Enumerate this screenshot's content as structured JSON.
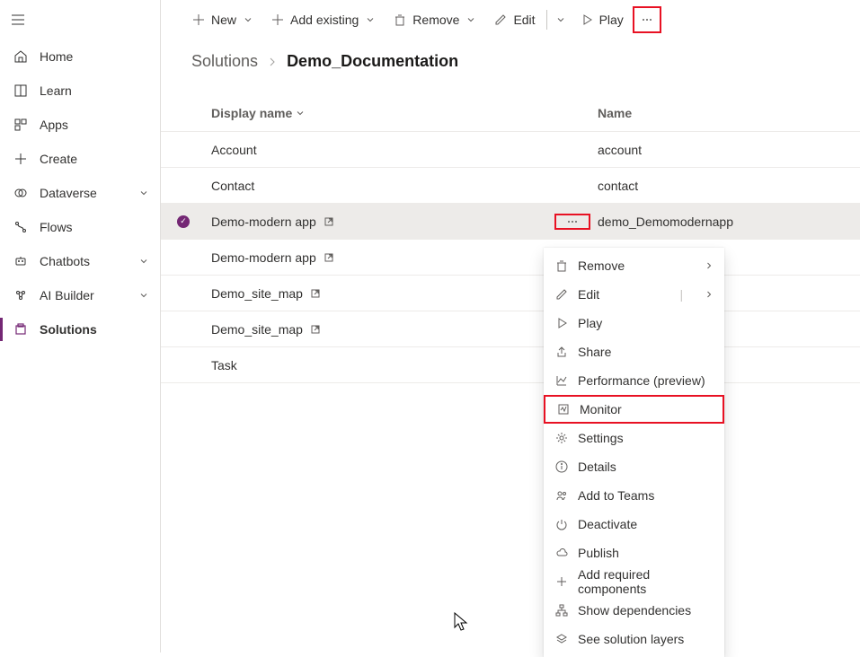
{
  "sidebar": {
    "items": [
      {
        "label": "Home"
      },
      {
        "label": "Learn"
      },
      {
        "label": "Apps"
      },
      {
        "label": "Create"
      },
      {
        "label": "Dataverse",
        "expandable": true
      },
      {
        "label": "Flows"
      },
      {
        "label": "Chatbots",
        "expandable": true
      },
      {
        "label": "AI Builder",
        "expandable": true
      },
      {
        "label": "Solutions",
        "selected": true
      }
    ]
  },
  "toolbar": {
    "new": "New",
    "add_existing": "Add existing",
    "remove": "Remove",
    "edit": "Edit",
    "play": "Play"
  },
  "breadcrumb": {
    "root": "Solutions",
    "current": "Demo_Documentation"
  },
  "table": {
    "headers": {
      "display_name": "Display name",
      "name": "Name"
    },
    "rows": [
      {
        "display": "Account",
        "name": "account",
        "ext": false
      },
      {
        "display": "Contact",
        "name": "contact",
        "ext": false
      },
      {
        "display": "Demo-modern app",
        "name": "demo_Demomodernapp",
        "ext": true,
        "selected": true
      },
      {
        "display": "Demo-modern app",
        "name": "",
        "ext": true
      },
      {
        "display": "Demo_site_map",
        "name": "",
        "ext": true
      },
      {
        "display": "Demo_site_map",
        "name": "",
        "ext": true
      },
      {
        "display": "Task",
        "name": "",
        "ext": false
      }
    ]
  },
  "context_menu": {
    "items": [
      {
        "label": "Remove",
        "icon": "trash",
        "submenu": true
      },
      {
        "label": "Edit",
        "icon": "pencil",
        "split": true
      },
      {
        "label": "Play",
        "icon": "play"
      },
      {
        "label": "Share",
        "icon": "share"
      },
      {
        "label": "Performance (preview)",
        "icon": "chart"
      },
      {
        "label": "Monitor",
        "icon": "monitor",
        "highlighted": true
      },
      {
        "label": "Settings",
        "icon": "gear"
      },
      {
        "label": "Details",
        "icon": "info"
      },
      {
        "label": "Add to Teams",
        "icon": "teams"
      },
      {
        "label": "Deactivate",
        "icon": "power"
      },
      {
        "label": "Publish",
        "icon": "cloud"
      },
      {
        "label": "Add required components",
        "icon": "plus"
      },
      {
        "label": "Show dependencies",
        "icon": "hierarchy"
      },
      {
        "label": "See solution layers",
        "icon": "layers"
      }
    ]
  }
}
